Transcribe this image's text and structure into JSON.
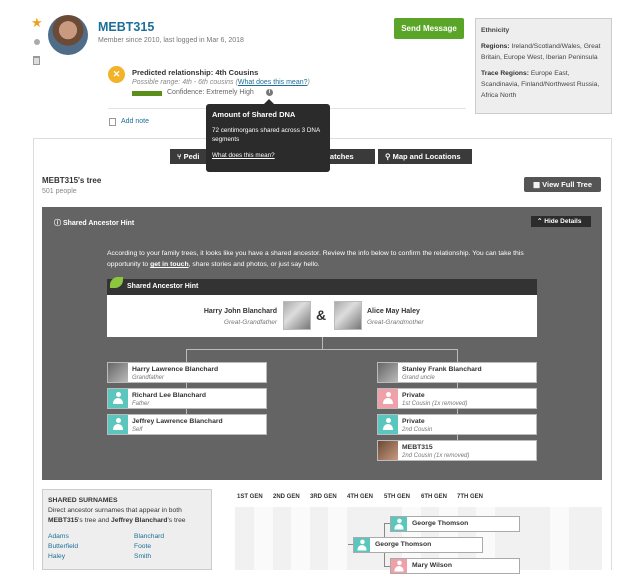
{
  "profile": {
    "username": "MEBT315",
    "member_info": "Member since 2010, last logged in Mar 6, 2018",
    "send_message": "Send Message"
  },
  "prediction": {
    "title": "Predicted relationship: 4th Cousins",
    "range_prefix": "Possible range: 4th - 6th cousins (",
    "range_link": "What does this mean?",
    "range_suffix": ")",
    "confidence": "Confidence: Extremely High",
    "info_icon": "i"
  },
  "add_note": "Add note",
  "ethnicity": {
    "title": "Ethnicity",
    "regions_label": "Regions:",
    "regions": "Ireland/Scotland/Wales, Great Britain, Europe West, Iberian Peninsula",
    "trace_label": "Trace Regions:",
    "trace": "Europe East, Scandinavia, Finland/Northwest Russia, Africa North"
  },
  "tooltip": {
    "title": "Amount of Shared DNA",
    "body": "72 centimorgans shared across 3 DNA segments",
    "link": "What does this mean?"
  },
  "tabs": [
    {
      "label": "Pedi"
    },
    {
      "label": "d Matches"
    },
    {
      "label": "Map and Locations"
    }
  ],
  "tree": {
    "title": "MEBT315's tree",
    "count": "501 people",
    "view_full": "View Full Tree"
  },
  "hint": {
    "header": "Shared Ancestor Hint",
    "hide": "Hide Details",
    "text_a": "According to your family trees, it looks like you have a shared ancestor. Review the info below to confirm the relationship. You can take this opportunity to ",
    "text_link": "get in touch",
    "text_b": ", share stories and photos, or just say hello.",
    "box_title": "Shared Ancestor Hint",
    "ancestor1_name": "Harry John Blanchard",
    "ancestor1_rel": "Great-Grandfather",
    "amp": "&",
    "ancestor2_name": "Alice May Haley",
    "ancestor2_rel": "Great-Grandmother"
  },
  "left_line": [
    {
      "name": "Harry Lawrence Blanchard",
      "rel": "Grandfather"
    },
    {
      "name": "Richard Lee Blanchard",
      "rel": "Father"
    },
    {
      "name": "Jeffrey Lawrence Blanchard",
      "rel": "Self"
    }
  ],
  "right_line": [
    {
      "name": "Stanley Frank Blanchard",
      "rel": "Grand uncle"
    },
    {
      "name": "Private",
      "rel": "1st Cousin (1x removed)"
    },
    {
      "name": "Private",
      "rel": "2nd Cousin"
    },
    {
      "name": "MEBT315",
      "rel": "2nd Cousin (1x removed)"
    }
  ],
  "surnames": {
    "title": "SHARED SURNAMES",
    "desc_a": "Direct ancestor surnames that appear in both ",
    "desc_b": "MEBT315",
    "desc_c": "'s tree and ",
    "desc_d": "Jeffrey Blanchard",
    "desc_e": "'s tree",
    "col1": [
      "Adams",
      "Butterfield",
      "Haley"
    ],
    "col2": [
      "Blanchard",
      "Foote",
      "Smith"
    ]
  },
  "generations": [
    "1ST GEN",
    "2ND GEN",
    "3RD GEN",
    "4TH GEN",
    "5TH GEN",
    "6TH GEN",
    "7TH GEN"
  ],
  "pedigree": [
    {
      "name": "George Thomson"
    },
    {
      "name": "George Thomson"
    },
    {
      "name": "Mary Wilson"
    }
  ]
}
